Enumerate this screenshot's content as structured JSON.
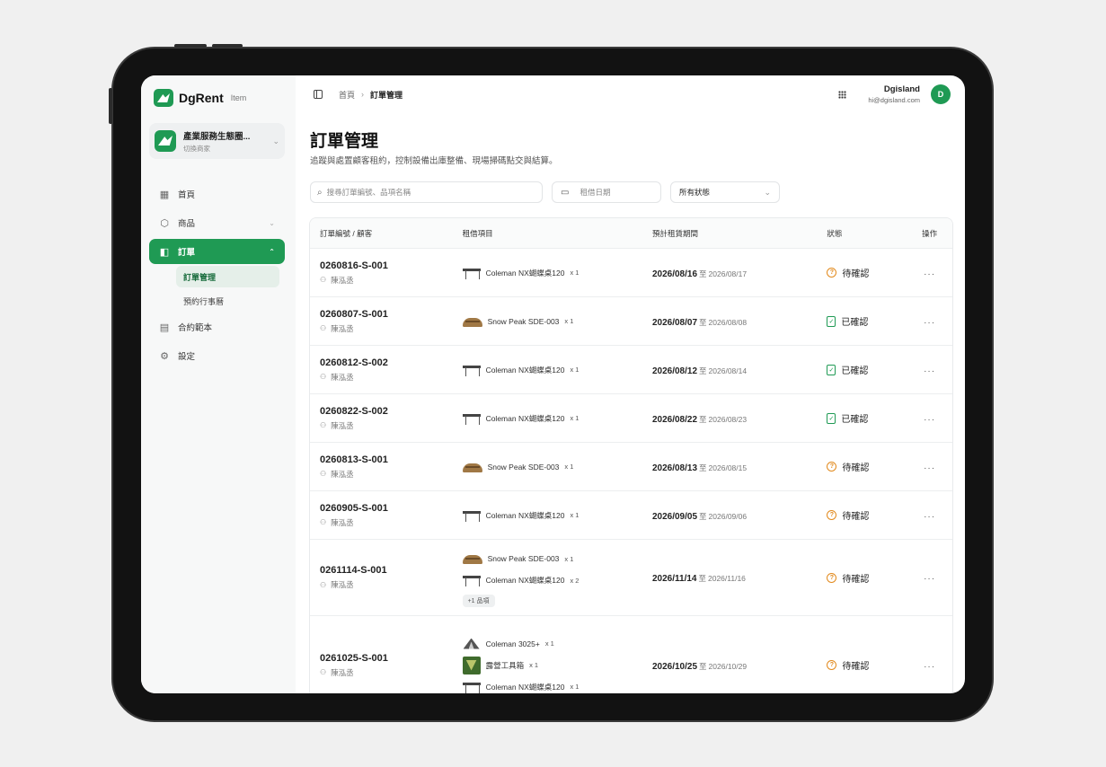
{
  "brand": {
    "name": "DgRent",
    "sub": "Item"
  },
  "store": {
    "name": "產業服務生態圈...",
    "sub": "切換商家"
  },
  "nav": [
    {
      "icon": "grid-icon",
      "label": "首頁"
    },
    {
      "icon": "box-icon",
      "label": "商品"
    },
    {
      "icon": "order-icon",
      "label": "訂單",
      "active": true
    },
    {
      "icon": "document-icon",
      "label": "合約範本"
    },
    {
      "icon": "settings-icon",
      "label": "設定"
    }
  ],
  "sub_nav": [
    "訂單管理",
    "預約行事曆"
  ],
  "breadcrumb": {
    "home": "首頁",
    "sep": "›",
    "current": "訂單管理"
  },
  "user": {
    "name": "Dgisland",
    "email": "hi@dgisland.com",
    "initial": "D"
  },
  "page": {
    "title": "訂單管理",
    "desc": "追蹤與處置顧客租約，控制設備出庫整備、現場掃碼點交與結算。"
  },
  "filters": {
    "search_placeholder": "搜尋訂單編號、品項名稱",
    "date_placeholder": "租借日期",
    "status_value": "所有狀態"
  },
  "table": {
    "headers": [
      "訂單編號 / 顧客",
      "租借項目",
      "預計租賃期間",
      "狀態",
      "操作"
    ],
    "period_sep": "至",
    "action": "···",
    "rows": [
      {
        "order": "0260816-S-001",
        "customer": "陳泓丞",
        "items": [
          {
            "name": "Coleman NX蝴蝶桌120",
            "qty": "x 1",
            "thumb": "table"
          }
        ],
        "start": "2026/08/16",
        "end": "2026/08/17",
        "status": "待確認",
        "status_type": "pending"
      },
      {
        "order": "0260807-S-001",
        "customer": "陳泓丞",
        "items": [
          {
            "name": "Snow Peak SDE-003",
            "qty": "x 1",
            "thumb": "tent"
          }
        ],
        "start": "2026/08/07",
        "end": "2026/08/08",
        "status": "已確認",
        "status_type": "confirmed"
      },
      {
        "order": "0260812-S-002",
        "customer": "陳泓丞",
        "items": [
          {
            "name": "Coleman NX蝴蝶桌120",
            "qty": "x 1",
            "thumb": "table"
          }
        ],
        "start": "2026/08/12",
        "end": "2026/08/14",
        "status": "已確認",
        "status_type": "confirmed"
      },
      {
        "order": "0260822-S-002",
        "customer": "陳泓丞",
        "items": [
          {
            "name": "Coleman NX蝴蝶桌120",
            "qty": "x 1",
            "thumb": "table"
          }
        ],
        "start": "2026/08/22",
        "end": "2026/08/23",
        "status": "已確認",
        "status_type": "confirmed"
      },
      {
        "order": "0260813-S-001",
        "customer": "陳泓丞",
        "items": [
          {
            "name": "Snow Peak SDE-003",
            "qty": "x 1",
            "thumb": "tent"
          }
        ],
        "start": "2026/08/13",
        "end": "2026/08/15",
        "status": "待確認",
        "status_type": "pending"
      },
      {
        "order": "0260905-S-001",
        "customer": "陳泓丞",
        "items": [
          {
            "name": "Coleman NX蝴蝶桌120",
            "qty": "x 1",
            "thumb": "table"
          }
        ],
        "start": "2026/09/05",
        "end": "2026/09/06",
        "status": "待確認",
        "status_type": "pending"
      },
      {
        "order": "0261114-S-001",
        "customer": "陳泓丞",
        "items": [
          {
            "name": "Snow Peak SDE-003",
            "qty": "x 1",
            "thumb": "tent"
          },
          {
            "name": "Coleman NX蝴蝶桌120",
            "qty": "x 2",
            "thumb": "table"
          }
        ],
        "more": "+1 品項",
        "start": "2026/11/14",
        "end": "2026/11/16",
        "status": "待確認",
        "status_type": "pending"
      },
      {
        "order": "0261025-S-001",
        "customer": "陳泓丞",
        "items": [
          {
            "name": "Coleman 3025+",
            "qty": "x 1",
            "thumb": "dome"
          },
          {
            "name": "露營工具箱",
            "qty": "x 1",
            "thumb": "box"
          },
          {
            "name": "Coleman NX蝴蝶桌120",
            "qty": "x 1",
            "thumb": "table"
          }
        ],
        "start": "2026/10/25",
        "end": "2026/10/29",
        "status": "待確認",
        "status_type": "pending"
      }
    ]
  },
  "colors": {
    "accent": "#1f9a54",
    "pending": "#e28a1d",
    "confirmed": "#1f9a54"
  }
}
